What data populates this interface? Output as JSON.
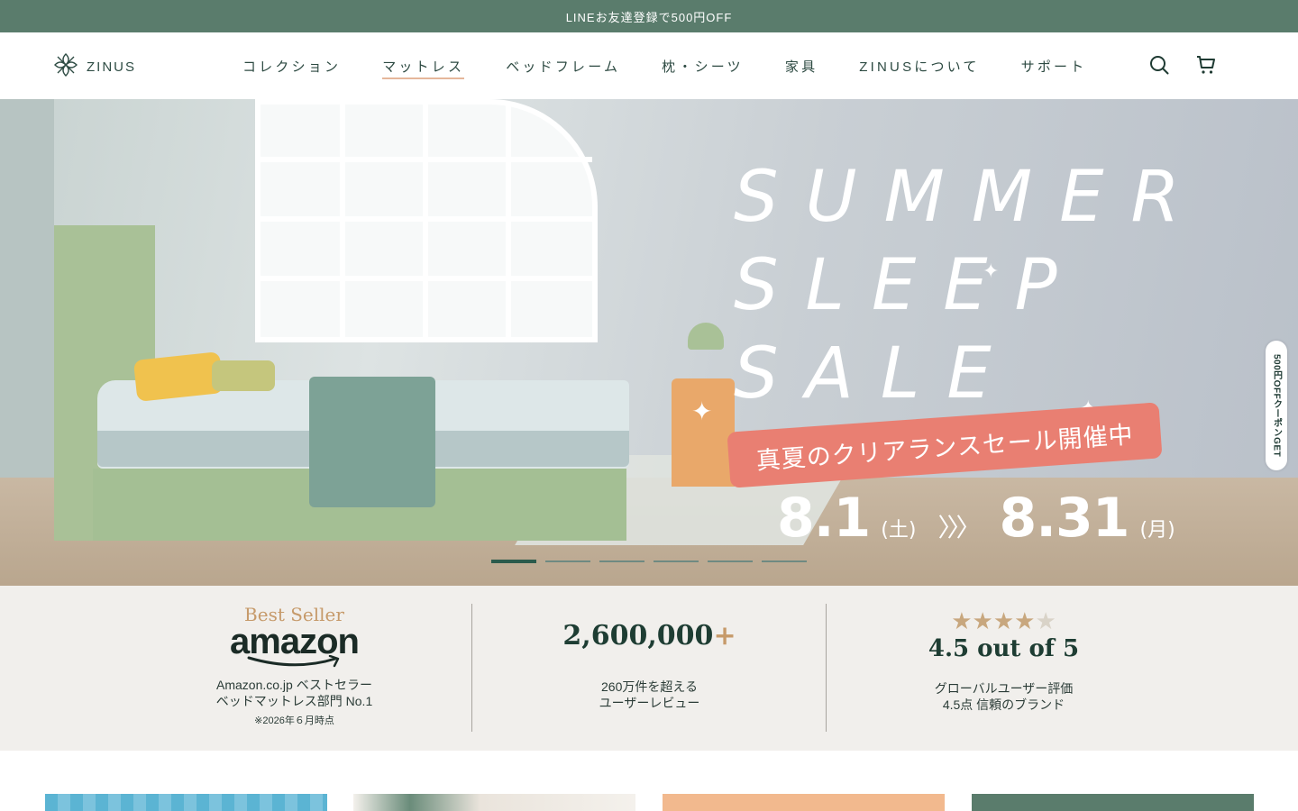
{
  "announcement": {
    "text": "LINEお友達登録で500円OFF"
  },
  "header": {
    "logo_text": "ZINUS",
    "nav": [
      {
        "label": "コレクション"
      },
      {
        "label": "マットレス"
      },
      {
        "label": "ベッドフレーム"
      },
      {
        "label": "枕・シーツ"
      },
      {
        "label": "家具"
      },
      {
        "label": "ZINUSについて"
      },
      {
        "label": "サポート"
      }
    ],
    "active_nav_index": 1,
    "icons": [
      "search-icon",
      "cart-icon"
    ]
  },
  "hero": {
    "title_lines": [
      "SUMMER",
      "SLEEP",
      "SALE"
    ],
    "ribbon_text": "真夏のクリアランスセール開催中",
    "start_date": "8.1",
    "start_day": "(土)",
    "arrow": "〉〉〉",
    "end_date": "8.31",
    "end_day": "(月)",
    "slide_count": 6,
    "active_slide": 1,
    "side_tab": "500円OFFクーポンGET"
  },
  "stats": {
    "amazon": {
      "badge": "Best Seller",
      "brand": "amazon",
      "line1": "Amazon.co.jp ベストセラー",
      "line2": "ベッドマットレス部門 No.1",
      "note": "※2026年６月時点"
    },
    "reviews": {
      "number": "2,600,000",
      "plus": "+",
      "line1": "260万件を超える",
      "line2": "ユーザーレビュー"
    },
    "rating": {
      "stars": 4.5,
      "label": "4.5 out of 5",
      "line1": "グローバルユーザー評価",
      "line2": "4.5点 信頼のブランド"
    }
  },
  "colors": {
    "brand_green": "#5a7c6c",
    "accent_tan": "#c69a6a",
    "strip_bg": "#f1efec",
    "ribbon": "#e97f72"
  }
}
